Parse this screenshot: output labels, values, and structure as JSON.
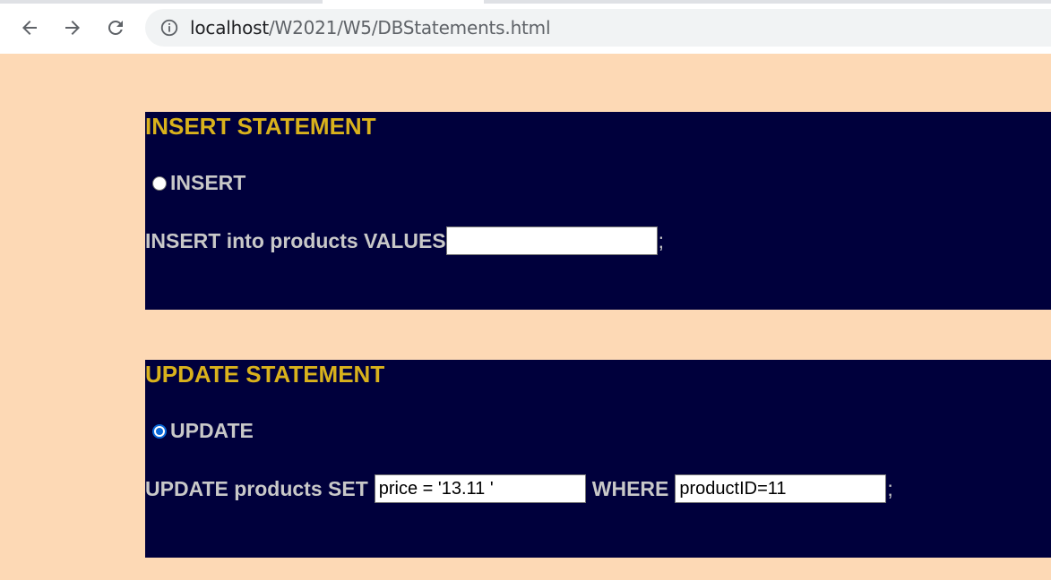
{
  "browser": {
    "url_host": "localhost",
    "url_path": "/W2021/W5/DBStatements.html",
    "icons": {
      "back": "arrow-left-icon",
      "forward": "arrow-right-icon",
      "reload": "reload-icon",
      "info": "info-icon"
    }
  },
  "insert": {
    "heading": "INSERT STATEMENT",
    "radio_label": "INSERT",
    "radio_checked": false,
    "prefix": "INSERT into products VALUES",
    "values_value": "",
    "terminator": ";"
  },
  "update": {
    "heading": "UPDATE STATEMENT",
    "radio_label": "UPDATE",
    "radio_checked": true,
    "prefix": "UPDATE products SET",
    "set_value": "price = '13.11 '",
    "where_label": "WHERE",
    "where_value": "productID=11",
    "terminator": ";"
  },
  "colors": {
    "page_bg": "#fdd9b5",
    "panel_bg": "#00003c",
    "heading": "#d9b21c",
    "label": "#c8c8c8",
    "radio_accent": "#0a68d8"
  }
}
